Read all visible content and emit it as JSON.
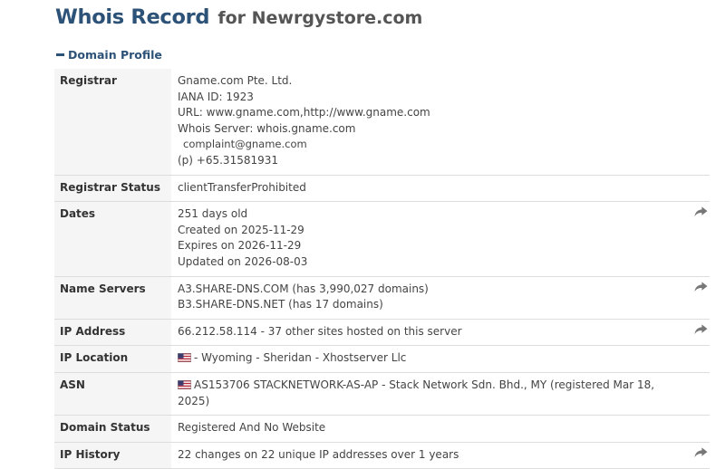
{
  "header": {
    "title": "Whois Record",
    "for_text": "for Newrgystore.com"
  },
  "section": {
    "label": "Domain Profile"
  },
  "colors": {
    "title": "#2d5278",
    "label_bg": "#f5f5f5",
    "border": "#dddddd",
    "share_icon": "#777777"
  },
  "rows": [
    {
      "label": "Registrar",
      "lines": [
        "Gname.com Pte. Ltd.",
        "IANA ID: 1923",
        "URL: www.gname.com,http://www.gname.com",
        "Whois Server: whois.gname.com",
        "complaint@gname.com",
        "(p) +65.31581931"
      ]
    },
    {
      "label": "Registrar Status",
      "lines": [
        "clientTransferProhibited"
      ]
    },
    {
      "label": "Dates",
      "icon": "share-arrow-icon",
      "lines": [
        "251 days old",
        "Created on 2025-11-29",
        "Expires on 2026-11-29",
        "Updated on 2026-08-03"
      ]
    },
    {
      "label": "Name Servers",
      "icon": "share-arrow-icon",
      "lines": [
        "A3.SHARE-DNS.COM (has 3,990,027 domains)",
        "B3.SHARE-DNS.NET (has 17 domains)"
      ]
    },
    {
      "label": "IP Address",
      "icon": "share-arrow-icon",
      "lines": [
        "66.212.58.114 - 37 other sites hosted on this server"
      ]
    },
    {
      "label": "IP Location",
      "flag": "us-flag-icon",
      "lines": [
        "- Wyoming - Sheridan - Xhostserver Llc"
      ]
    },
    {
      "label": "ASN",
      "flag": "us-flag-icon",
      "lines": [
        "AS153706 STACKNETWORK-AS-AP - Stack Network Sdn. Bhd., MY (registered Mar 18, 2025)"
      ]
    },
    {
      "label": "Domain Status",
      "lines": [
        "Registered And No Website"
      ]
    },
    {
      "label": "IP History",
      "icon": "share-arrow-icon",
      "lines": [
        "22 changes on 22 unique IP addresses over 1 years"
      ]
    }
  ]
}
